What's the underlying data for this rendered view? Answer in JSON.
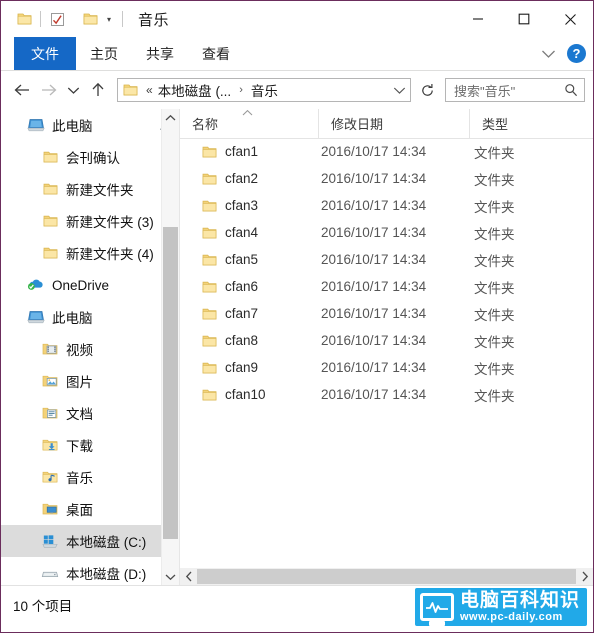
{
  "window": {
    "title": "音乐",
    "border_color": "#6b2d5c",
    "accent_color": "#1568c6"
  },
  "titlebar": {
    "quick_access": [
      {
        "name": "folder-icon",
        "label": "新建文件夹"
      },
      {
        "name": "properties-icon",
        "label": "属性"
      },
      {
        "name": "new-folder-icon",
        "label": "新建文件夹"
      }
    ],
    "customize_caret": "▾",
    "minimize_label": "最小化",
    "maximize_label": "最大化",
    "close_label": "关闭"
  },
  "ribbon": {
    "tabs": [
      {
        "label": "文件",
        "active": true
      },
      {
        "label": "主页",
        "active": false
      },
      {
        "label": "共享",
        "active": false
      },
      {
        "label": "查看",
        "active": false
      }
    ],
    "expand_caret": "⌄",
    "help_glyph": "?"
  },
  "addressbar": {
    "back_glyph": "←",
    "forward_glyph": "→",
    "recent_glyph": "⌄",
    "up_glyph": "↑",
    "breadcrumb": {
      "overflow": "«",
      "items": [
        "本地磁盘 (...",
        "音乐"
      ],
      "separator": "›",
      "dropdown_caret": "⌄"
    },
    "refresh_glyph": "↻",
    "search": {
      "placeholder": "搜索\"音乐\"",
      "icon": "search-icon"
    }
  },
  "sidebar": {
    "items": [
      {
        "label": "此电脑",
        "icon": "computer-icon",
        "indent": 0,
        "pinned": true,
        "selected": false
      },
      {
        "label": "会刊确认",
        "icon": "folder-icon",
        "indent": 1,
        "pinned": false,
        "selected": false
      },
      {
        "label": "新建文件夹",
        "icon": "folder-icon",
        "indent": 1,
        "pinned": false,
        "selected": false
      },
      {
        "label": "新建文件夹 (3)",
        "icon": "folder-icon",
        "indent": 1,
        "pinned": false,
        "selected": false
      },
      {
        "label": "新建文件夹 (4)",
        "icon": "folder-icon",
        "indent": 1,
        "pinned": false,
        "selected": false
      },
      {
        "label": "OneDrive",
        "icon": "onedrive-icon",
        "indent": 0,
        "pinned": false,
        "selected": false
      },
      {
        "label": "此电脑",
        "icon": "computer-icon",
        "indent": 0,
        "pinned": false,
        "selected": false
      },
      {
        "label": "视频",
        "icon": "videos-icon",
        "indent": 1,
        "pinned": false,
        "selected": false
      },
      {
        "label": "图片",
        "icon": "pictures-icon",
        "indent": 1,
        "pinned": false,
        "selected": false
      },
      {
        "label": "文档",
        "icon": "documents-icon",
        "indent": 1,
        "pinned": false,
        "selected": false
      },
      {
        "label": "下载",
        "icon": "downloads-icon",
        "indent": 1,
        "pinned": false,
        "selected": false
      },
      {
        "label": "音乐",
        "icon": "music-icon",
        "indent": 1,
        "pinned": false,
        "selected": false
      },
      {
        "label": "桌面",
        "icon": "desktop-icon",
        "indent": 1,
        "pinned": false,
        "selected": false
      },
      {
        "label": "本地磁盘 (C:)",
        "icon": "windows-drive-icon",
        "indent": 1,
        "pinned": false,
        "selected": true
      },
      {
        "label": "本地磁盘 (D:)",
        "icon": "drive-icon",
        "indent": 1,
        "pinned": false,
        "selected": false
      }
    ],
    "scroll_up_glyph": "⌃",
    "scroll_down_glyph": "⌄"
  },
  "filelist": {
    "columns": [
      {
        "key": "name",
        "label": "名称",
        "sorted": "asc",
        "sort_glyph": "⌃"
      },
      {
        "key": "date",
        "label": "修改日期",
        "sorted": null,
        "sort_glyph": ""
      },
      {
        "key": "type",
        "label": "类型",
        "sorted": null,
        "sort_glyph": ""
      }
    ],
    "rows": [
      {
        "name": "cfan1",
        "date": "2016/10/17 14:34",
        "type": "文件夹",
        "icon": "folder-icon"
      },
      {
        "name": "cfan2",
        "date": "2016/10/17 14:34",
        "type": "文件夹",
        "icon": "folder-icon"
      },
      {
        "name": "cfan3",
        "date": "2016/10/17 14:34",
        "type": "文件夹",
        "icon": "folder-icon"
      },
      {
        "name": "cfan4",
        "date": "2016/10/17 14:34",
        "type": "文件夹",
        "icon": "folder-icon"
      },
      {
        "name": "cfan5",
        "date": "2016/10/17 14:34",
        "type": "文件夹",
        "icon": "folder-icon"
      },
      {
        "name": "cfan6",
        "date": "2016/10/17 14:34",
        "type": "文件夹",
        "icon": "folder-icon"
      },
      {
        "name": "cfan7",
        "date": "2016/10/17 14:34",
        "type": "文件夹",
        "icon": "folder-icon"
      },
      {
        "name": "cfan8",
        "date": "2016/10/17 14:34",
        "type": "文件夹",
        "icon": "folder-icon"
      },
      {
        "name": "cfan9",
        "date": "2016/10/17 14:34",
        "type": "文件夹",
        "icon": "folder-icon"
      },
      {
        "name": "cfan10",
        "date": "2016/10/17 14:34",
        "type": "文件夹",
        "icon": "folder-icon"
      }
    ],
    "hscroll_left_glyph": "‹",
    "hscroll_right_glyph": "›"
  },
  "statusbar": {
    "item_count_text": "10 个项目"
  },
  "watermark": {
    "title": "电脑百科知识",
    "url": "www.pc-daily.com",
    "color": "#21a9e8"
  }
}
